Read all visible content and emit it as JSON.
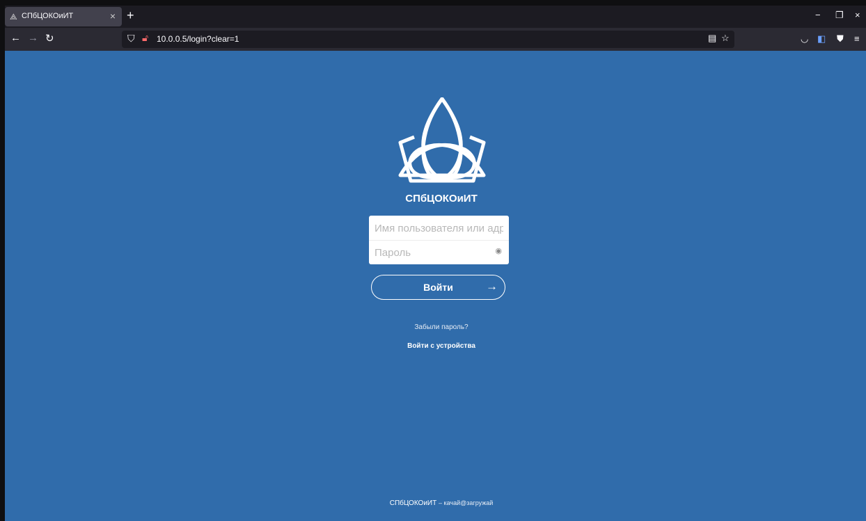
{
  "browser": {
    "tab_title": "СПбЦОКОиИТ",
    "tab_close": "×",
    "new_tab": "+",
    "url": "10.0.0.5/login?clear=1",
    "window": {
      "minimize": "−",
      "restore": "❐",
      "close": "×"
    }
  },
  "page": {
    "brand": "СПбЦОКОиИТ",
    "username_placeholder": "Имя пользователя или адрес эл. почты",
    "password_placeholder": "Пароль",
    "login_label": "Войти",
    "login_arrow": "→",
    "forgot": "Забыли пароль?",
    "device_login": "Войти с устройства",
    "footer_name": "СПбЦОКОиИТ",
    "footer_sub": "– качай@загружай"
  },
  "colors": {
    "page_bg": "#306cab",
    "chrome_dark": "#1c1b22"
  }
}
